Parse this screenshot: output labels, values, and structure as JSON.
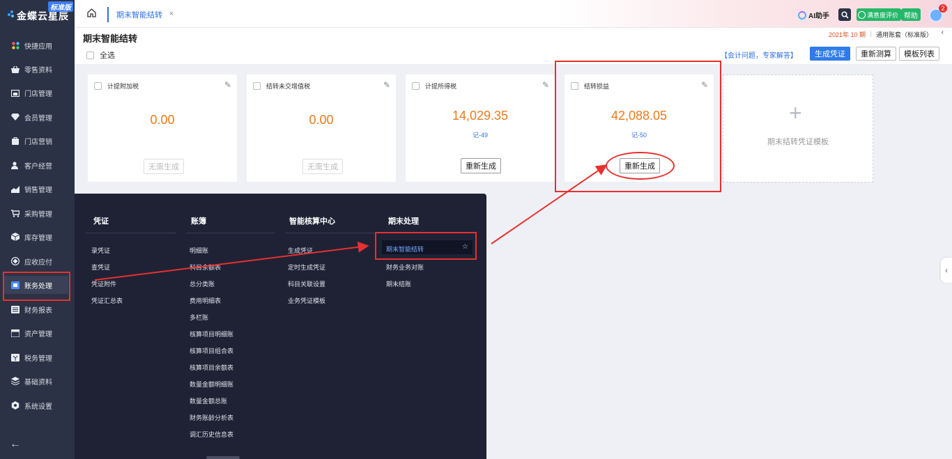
{
  "app": {
    "logo_text": "金蝶云星辰",
    "edition_badge": "标准版"
  },
  "sidebar": {
    "items": [
      {
        "label": "快捷应用",
        "icon": "apps-grid-icon"
      },
      {
        "label": "零售资料",
        "icon": "basket-icon"
      },
      {
        "label": "门店管理",
        "icon": "store-icon"
      },
      {
        "label": "会员管理",
        "icon": "diamond-icon"
      },
      {
        "label": "门店营销",
        "icon": "bag-icon"
      },
      {
        "label": "客户经营",
        "icon": "customer-icon"
      },
      {
        "label": "销售管理",
        "icon": "sales-chart-icon"
      },
      {
        "label": "采购管理",
        "icon": "cart-icon"
      },
      {
        "label": "库存管理",
        "icon": "cube-icon"
      },
      {
        "label": "应收应付",
        "icon": "receivable-icon"
      },
      {
        "label": "账务处理",
        "icon": "ledger-icon"
      },
      {
        "label": "财务报表",
        "icon": "report-icon"
      },
      {
        "label": "资产管理",
        "icon": "asset-icon"
      },
      {
        "label": "税务管理",
        "icon": "tax-icon"
      },
      {
        "label": "基础资料",
        "icon": "layers-icon"
      },
      {
        "label": "系统设置",
        "icon": "gear-icon"
      }
    ],
    "active_index": 10
  },
  "topbar": {
    "tab_label": "期末智能结转",
    "tab_close": "×",
    "ai_label": "AI助手",
    "rating_label": "满意度评价",
    "help_label": "帮助",
    "notification_count": "2"
  },
  "page": {
    "title": "期末智能结转",
    "select_all": "全选",
    "period": "2021年 10 期",
    "separator": "|",
    "account_book": "通用账套（标准版）",
    "help_link": "【会计问题，专家解答】",
    "buttons": {
      "generate": "生成凭证",
      "recalculate": "重新测算",
      "template_list": "模板列表"
    }
  },
  "cards": [
    {
      "name": "计提附加税",
      "amount": "0.00",
      "voucher": "",
      "button": "无需生成",
      "disabled": true
    },
    {
      "name": "结转未交增值税",
      "amount": "0.00",
      "voucher": "",
      "button": "无需生成",
      "disabled": true
    },
    {
      "name": "计提所得税",
      "amount": "14,029.35",
      "voucher": "记-49",
      "button": "重新生成",
      "disabled": false
    },
    {
      "name": "结转损益",
      "amount": "42,088.05",
      "voucher": "记-50",
      "button": "重新生成",
      "disabled": false
    }
  ],
  "add_card_label": "期末结转凭证模板",
  "menu": {
    "columns": [
      {
        "title": "凭证",
        "items": [
          "录凭证",
          "查凭证",
          "凭证附件",
          "凭证汇总表"
        ]
      },
      {
        "title": "账簿",
        "items": [
          "明细账",
          "科目余额表",
          "总分类账",
          "费用明细表",
          "多栏账",
          "核算项目明细账",
          "核算项目组合表",
          "核算项目余额表",
          "数量金额明细账",
          "数量金额总账",
          "财务账龄分析表",
          "调汇历史信息表"
        ]
      },
      {
        "title": "智能核算中心",
        "items": [
          "生成凭证",
          "定时生成凭证",
          "科目关联设置",
          "业务凭证模板"
        ]
      },
      {
        "title": "期末处理",
        "items": [
          "期末智能结转",
          "财务业务对账",
          "期末结账"
        ]
      }
    ],
    "highlighted_item": "期末智能结转"
  },
  "colors": {
    "sidebar_bg": "#2b3245",
    "menu_bg": "#1f2235",
    "accent": "#2f7be8",
    "amount": "#ee7a1b",
    "annotation": "#e8302f"
  }
}
